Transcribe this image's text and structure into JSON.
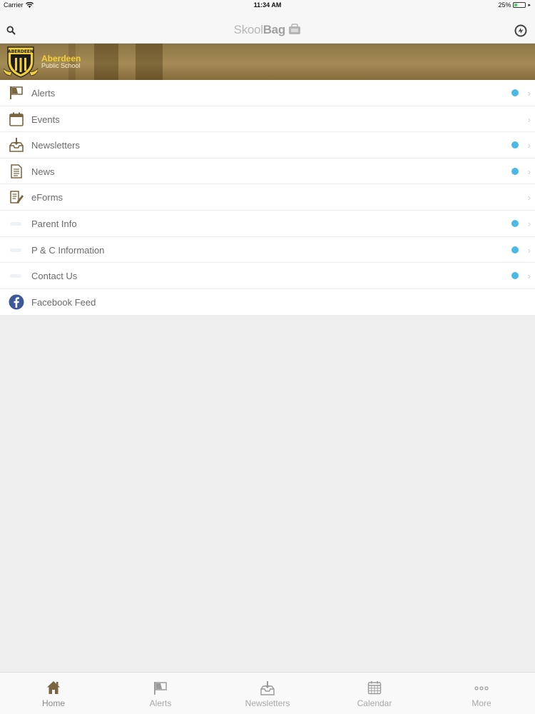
{
  "status_bar": {
    "carrier": "Carrier",
    "time": "11:34 AM",
    "battery": "25%"
  },
  "nav": {
    "logo_light": "Skool",
    "logo_bold": "Bag"
  },
  "banner": {
    "school_name": "Aberdeen",
    "school_subtitle": "Public School",
    "crest_text": "ABERDEEN"
  },
  "menu": [
    {
      "label": "Alerts",
      "icon": "flag-icon",
      "has_dot": true
    },
    {
      "label": "Events",
      "icon": "calendar-icon",
      "has_dot": false
    },
    {
      "label": "Newsletters",
      "icon": "inbox-download-icon",
      "has_dot": true
    },
    {
      "label": "News",
      "icon": "document-icon",
      "has_dot": true
    },
    {
      "label": "eForms",
      "icon": "form-edit-icon",
      "has_dot": false
    },
    {
      "label": "Parent Info",
      "icon": "placeholder-icon",
      "has_dot": true
    },
    {
      "label": "P & C Information",
      "icon": "placeholder-icon",
      "has_dot": true
    },
    {
      "label": "Contact Us",
      "icon": "placeholder-icon",
      "has_dot": true
    },
    {
      "label": "Facebook Feed",
      "icon": "facebook-icon",
      "has_dot": false
    }
  ],
  "tabs": [
    {
      "label": "Home",
      "icon": "home-icon",
      "active": true
    },
    {
      "label": "Alerts",
      "icon": "flag-icon",
      "active": false
    },
    {
      "label": "Newsletters",
      "icon": "inbox-download-icon",
      "active": false
    },
    {
      "label": "Calendar",
      "icon": "calendar-grid-icon",
      "active": false
    },
    {
      "label": "More",
      "icon": "more-dots-icon",
      "active": false
    }
  ],
  "colors": {
    "accent_dot": "#4bb9e8",
    "brand_gold": "#f3cf3a",
    "banner_brown": "#a58c56",
    "icon_brown": "#7a6540",
    "facebook_blue": "#3b5998"
  }
}
